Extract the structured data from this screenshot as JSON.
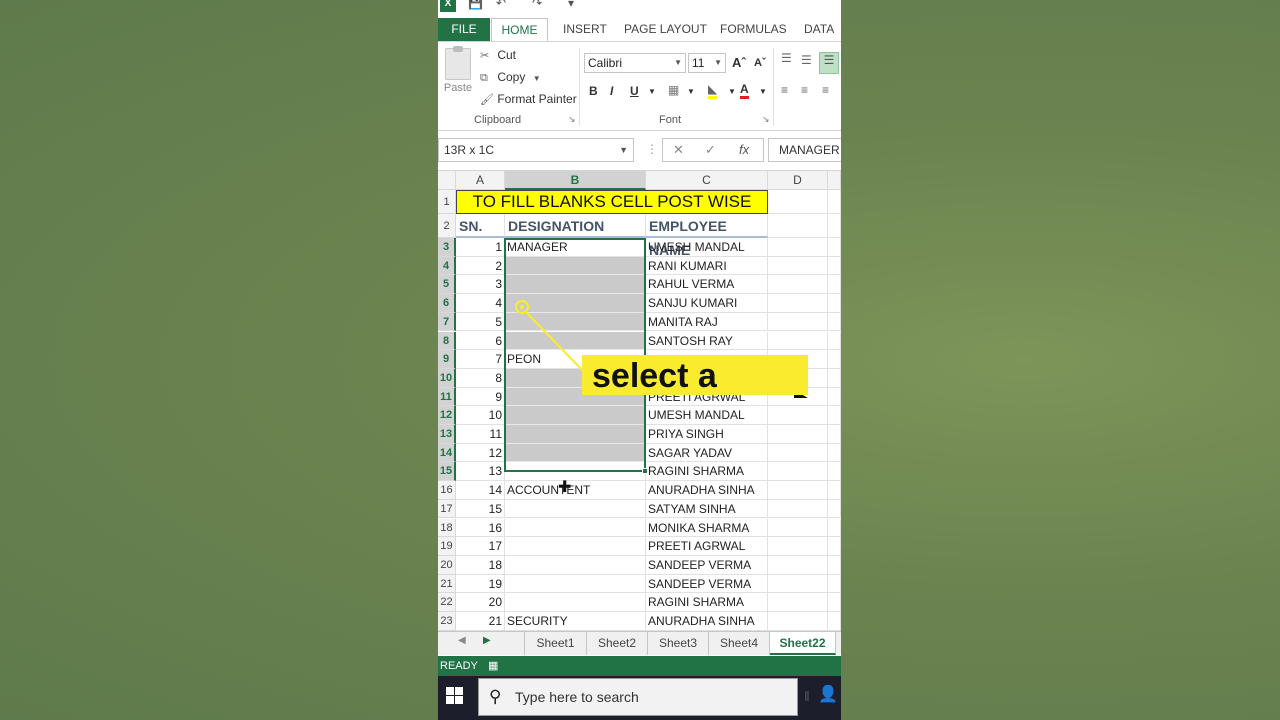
{
  "app": {
    "logo": "X"
  },
  "ribbon_tabs": [
    "FILE",
    "HOME",
    "INSERT",
    "PAGE LAYOUT",
    "FORMULAS",
    "DATA"
  ],
  "clipboard": {
    "paste": "Paste",
    "cut": "Cut",
    "copy": "Copy",
    "format_painter": "Format Painter",
    "group": "Clipboard"
  },
  "font": {
    "name": "Calibri",
    "size": "11",
    "bold": "B",
    "italic": "I",
    "underline": "U",
    "group": "Font"
  },
  "formula_bar": {
    "name_box": "13R x 1C",
    "content": "MANAGER",
    "fx": "fx"
  },
  "columns": [
    "A",
    "B",
    "C",
    "D"
  ],
  "title": "TO FILL BLANKS CELL POST WISE",
  "headers": {
    "sn": "SN.",
    "designation": "DESIGNATION",
    "employee": "EMPLOYEE NAME"
  },
  "rows": [
    {
      "r": "3",
      "sn": "1",
      "designation": "MANAGER",
      "name": "UMESH MANDAL"
    },
    {
      "r": "4",
      "sn": "2",
      "designation": "",
      "name": "RANI KUMARI"
    },
    {
      "r": "5",
      "sn": "3",
      "designation": "",
      "name": "RAHUL VERMA"
    },
    {
      "r": "6",
      "sn": "4",
      "designation": "",
      "name": "SANJU KUMARI"
    },
    {
      "r": "7",
      "sn": "5",
      "designation": "",
      "name": "MANITA RAJ"
    },
    {
      "r": "8",
      "sn": "6",
      "designation": "",
      "name": "SANTOSH RAY"
    },
    {
      "r": "9",
      "sn": "7",
      "designation": "PEON",
      "name": ""
    },
    {
      "r": "10",
      "sn": "8",
      "designation": "",
      "name": ""
    },
    {
      "r": "11",
      "sn": "9",
      "designation": "",
      "name": "PREETI AGRWAL"
    },
    {
      "r": "12",
      "sn": "10",
      "designation": "",
      "name": "UMESH MANDAL"
    },
    {
      "r": "13",
      "sn": "11",
      "designation": "",
      "name": "PRIYA SINGH"
    },
    {
      "r": "14",
      "sn": "12",
      "designation": "",
      "name": "SAGAR YADAV"
    },
    {
      "r": "15",
      "sn": "13",
      "designation": "",
      "name": "RAGINI SHARMA"
    },
    {
      "r": "16",
      "sn": "14",
      "designation": "ACCOUNTENT",
      "name": "ANURADHA SINHA"
    },
    {
      "r": "17",
      "sn": "15",
      "designation": "",
      "name": "SATYAM SINHA"
    },
    {
      "r": "18",
      "sn": "16",
      "designation": "",
      "name": "MONIKA SHARMA"
    },
    {
      "r": "19",
      "sn": "17",
      "designation": "",
      "name": "PREETI AGRWAL"
    },
    {
      "r": "20",
      "sn": "18",
      "designation": "",
      "name": "SANDEEP VERMA"
    },
    {
      "r": "21",
      "sn": "19",
      "designation": "",
      "name": "SANDEEP VERMA"
    },
    {
      "r": "22",
      "sn": "20",
      "designation": "",
      "name": "RAGINI SHARMA"
    },
    {
      "r": "23",
      "sn": "21",
      "designation": "SECURITY",
      "name": "ANURADHA SINHA"
    }
  ],
  "caption": "select a",
  "sheets": [
    "Sheet1",
    "Sheet2",
    "Sheet3",
    "Sheet4",
    "Sheet22"
  ],
  "status": "READY",
  "taskbar": {
    "search_placeholder": "Type here to search"
  },
  "colors": {
    "excel_green": "#217346",
    "title_fill": "#ffff00",
    "caption_fill": "#f9ec2e",
    "blank_fill": "#cacaca"
  }
}
